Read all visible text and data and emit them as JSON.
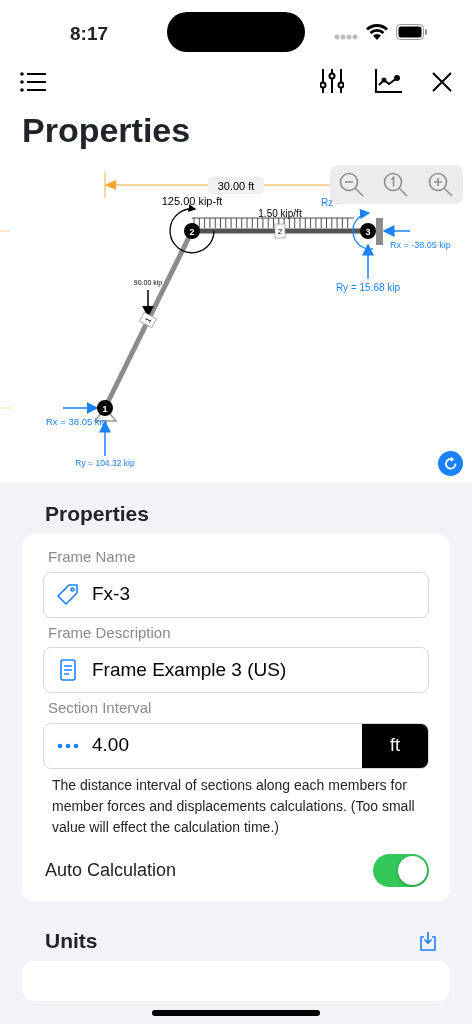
{
  "status_bar": {
    "time": "8:17"
  },
  "title": "Properties",
  "diagram": {
    "dimension": "30.00 ft",
    "moment": "125.00 kip-ft",
    "distributed_load": "1.50 kip/ft",
    "point_load": "90.00 kip",
    "members": [
      "1",
      "2"
    ],
    "nodes": [
      "1",
      "2",
      "3"
    ],
    "reactions": [
      {
        "kind": "rx",
        "text": "Rx = 38.05 kip"
      },
      {
        "kind": "ry",
        "text": "Ry = 104.32 kip"
      },
      {
        "kind": "rz",
        "text": "Rz ="
      },
      {
        "kind": "rx",
        "text": "Rx = -38.05 kip"
      },
      {
        "kind": "ry",
        "text": "Ry = 15.68 kip"
      }
    ]
  },
  "properties": {
    "title": "Properties",
    "fields": [
      {
        "kind": "name",
        "label": "Frame Name",
        "value": "Fx-3"
      },
      {
        "kind": "description",
        "label": "Frame Description",
        "value": "Frame Example 3 (US)"
      },
      {
        "kind": "interval",
        "label": "Section Interval",
        "value": "4.00",
        "unit": "ft"
      }
    ],
    "help": "The distance interval of sections along each members for member forces and displacements calculations. (Too small value will effect the calculation time.)",
    "toggle": {
      "label": "Auto Calculation",
      "on": true
    }
  },
  "units": {
    "title": "Units"
  }
}
